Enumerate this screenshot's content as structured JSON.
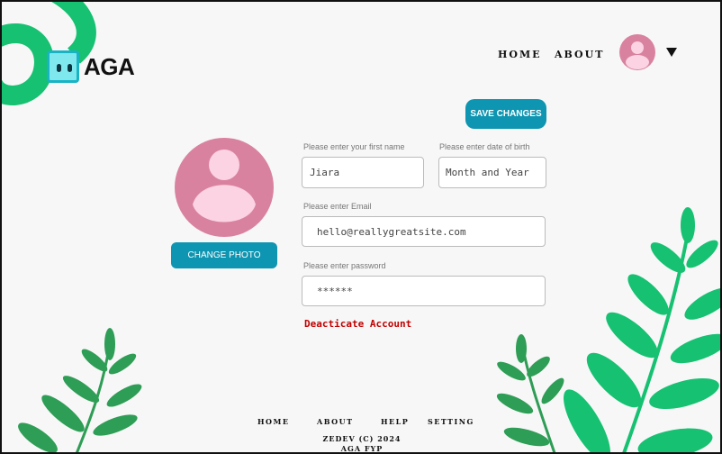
{
  "brand": {
    "name": "AGA"
  },
  "header": {
    "nav": [
      "HOME",
      "ABOUT"
    ]
  },
  "actions": {
    "save_changes": "SAVE CHANGES",
    "change_photo": "CHANGE PHOTO",
    "deactivate": "Deacticate Account"
  },
  "form": {
    "first_name": {
      "label": "Please enter your first name",
      "value": "Jiara"
    },
    "birth": {
      "label": "Please enter date of birth",
      "placeholder": "Month and Year"
    },
    "email": {
      "label": "Please enter Email",
      "value": "hello@reallygreatsite.com"
    },
    "password": {
      "label": "Please enter password",
      "value": "******"
    }
  },
  "footer": {
    "nav": [
      "HOME",
      "ABOUT",
      "HELP",
      "SETTING"
    ],
    "copyright": "ZEDEV (C) 2024",
    "project": "AGA FYP"
  },
  "colors": {
    "accent": "#0e95b1",
    "avatar": "#d9829f",
    "leaf": "#16c172",
    "danger": "#c00000"
  }
}
